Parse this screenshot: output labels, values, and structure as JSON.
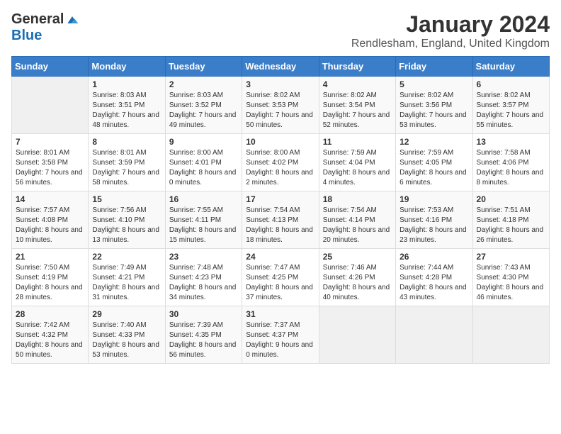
{
  "logo": {
    "general": "General",
    "blue": "Blue"
  },
  "title": "January 2024",
  "subtitle": "Rendlesham, England, United Kingdom",
  "days_of_week": [
    "Sunday",
    "Monday",
    "Tuesday",
    "Wednesday",
    "Thursday",
    "Friday",
    "Saturday"
  ],
  "weeks": [
    [
      {
        "day": "",
        "sunrise": "",
        "sunset": "",
        "daylight": ""
      },
      {
        "day": "1",
        "sunrise": "Sunrise: 8:03 AM",
        "sunset": "Sunset: 3:51 PM",
        "daylight": "Daylight: 7 hours and 48 minutes."
      },
      {
        "day": "2",
        "sunrise": "Sunrise: 8:03 AM",
        "sunset": "Sunset: 3:52 PM",
        "daylight": "Daylight: 7 hours and 49 minutes."
      },
      {
        "day": "3",
        "sunrise": "Sunrise: 8:02 AM",
        "sunset": "Sunset: 3:53 PM",
        "daylight": "Daylight: 7 hours and 50 minutes."
      },
      {
        "day": "4",
        "sunrise": "Sunrise: 8:02 AM",
        "sunset": "Sunset: 3:54 PM",
        "daylight": "Daylight: 7 hours and 52 minutes."
      },
      {
        "day": "5",
        "sunrise": "Sunrise: 8:02 AM",
        "sunset": "Sunset: 3:56 PM",
        "daylight": "Daylight: 7 hours and 53 minutes."
      },
      {
        "day": "6",
        "sunrise": "Sunrise: 8:02 AM",
        "sunset": "Sunset: 3:57 PM",
        "daylight": "Daylight: 7 hours and 55 minutes."
      }
    ],
    [
      {
        "day": "7",
        "sunrise": "Sunrise: 8:01 AM",
        "sunset": "Sunset: 3:58 PM",
        "daylight": "Daylight: 7 hours and 56 minutes."
      },
      {
        "day": "8",
        "sunrise": "Sunrise: 8:01 AM",
        "sunset": "Sunset: 3:59 PM",
        "daylight": "Daylight: 7 hours and 58 minutes."
      },
      {
        "day": "9",
        "sunrise": "Sunrise: 8:00 AM",
        "sunset": "Sunset: 4:01 PM",
        "daylight": "Daylight: 8 hours and 0 minutes."
      },
      {
        "day": "10",
        "sunrise": "Sunrise: 8:00 AM",
        "sunset": "Sunset: 4:02 PM",
        "daylight": "Daylight: 8 hours and 2 minutes."
      },
      {
        "day": "11",
        "sunrise": "Sunrise: 7:59 AM",
        "sunset": "Sunset: 4:04 PM",
        "daylight": "Daylight: 8 hours and 4 minutes."
      },
      {
        "day": "12",
        "sunrise": "Sunrise: 7:59 AM",
        "sunset": "Sunset: 4:05 PM",
        "daylight": "Daylight: 8 hours and 6 minutes."
      },
      {
        "day": "13",
        "sunrise": "Sunrise: 7:58 AM",
        "sunset": "Sunset: 4:06 PM",
        "daylight": "Daylight: 8 hours and 8 minutes."
      }
    ],
    [
      {
        "day": "14",
        "sunrise": "Sunrise: 7:57 AM",
        "sunset": "Sunset: 4:08 PM",
        "daylight": "Daylight: 8 hours and 10 minutes."
      },
      {
        "day": "15",
        "sunrise": "Sunrise: 7:56 AM",
        "sunset": "Sunset: 4:10 PM",
        "daylight": "Daylight: 8 hours and 13 minutes."
      },
      {
        "day": "16",
        "sunrise": "Sunrise: 7:55 AM",
        "sunset": "Sunset: 4:11 PM",
        "daylight": "Daylight: 8 hours and 15 minutes."
      },
      {
        "day": "17",
        "sunrise": "Sunrise: 7:54 AM",
        "sunset": "Sunset: 4:13 PM",
        "daylight": "Daylight: 8 hours and 18 minutes."
      },
      {
        "day": "18",
        "sunrise": "Sunrise: 7:54 AM",
        "sunset": "Sunset: 4:14 PM",
        "daylight": "Daylight: 8 hours and 20 minutes."
      },
      {
        "day": "19",
        "sunrise": "Sunrise: 7:53 AM",
        "sunset": "Sunset: 4:16 PM",
        "daylight": "Daylight: 8 hours and 23 minutes."
      },
      {
        "day": "20",
        "sunrise": "Sunrise: 7:51 AM",
        "sunset": "Sunset: 4:18 PM",
        "daylight": "Daylight: 8 hours and 26 minutes."
      }
    ],
    [
      {
        "day": "21",
        "sunrise": "Sunrise: 7:50 AM",
        "sunset": "Sunset: 4:19 PM",
        "daylight": "Daylight: 8 hours and 28 minutes."
      },
      {
        "day": "22",
        "sunrise": "Sunrise: 7:49 AM",
        "sunset": "Sunset: 4:21 PM",
        "daylight": "Daylight: 8 hours and 31 minutes."
      },
      {
        "day": "23",
        "sunrise": "Sunrise: 7:48 AM",
        "sunset": "Sunset: 4:23 PM",
        "daylight": "Daylight: 8 hours and 34 minutes."
      },
      {
        "day": "24",
        "sunrise": "Sunrise: 7:47 AM",
        "sunset": "Sunset: 4:25 PM",
        "daylight": "Daylight: 8 hours and 37 minutes."
      },
      {
        "day": "25",
        "sunrise": "Sunrise: 7:46 AM",
        "sunset": "Sunset: 4:26 PM",
        "daylight": "Daylight: 8 hours and 40 minutes."
      },
      {
        "day": "26",
        "sunrise": "Sunrise: 7:44 AM",
        "sunset": "Sunset: 4:28 PM",
        "daylight": "Daylight: 8 hours and 43 minutes."
      },
      {
        "day": "27",
        "sunrise": "Sunrise: 7:43 AM",
        "sunset": "Sunset: 4:30 PM",
        "daylight": "Daylight: 8 hours and 46 minutes."
      }
    ],
    [
      {
        "day": "28",
        "sunrise": "Sunrise: 7:42 AM",
        "sunset": "Sunset: 4:32 PM",
        "daylight": "Daylight: 8 hours and 50 minutes."
      },
      {
        "day": "29",
        "sunrise": "Sunrise: 7:40 AM",
        "sunset": "Sunset: 4:33 PM",
        "daylight": "Daylight: 8 hours and 53 minutes."
      },
      {
        "day": "30",
        "sunrise": "Sunrise: 7:39 AM",
        "sunset": "Sunset: 4:35 PM",
        "daylight": "Daylight: 8 hours and 56 minutes."
      },
      {
        "day": "31",
        "sunrise": "Sunrise: 7:37 AM",
        "sunset": "Sunset: 4:37 PM",
        "daylight": "Daylight: 9 hours and 0 minutes."
      },
      {
        "day": "",
        "sunrise": "",
        "sunset": "",
        "daylight": ""
      },
      {
        "day": "",
        "sunrise": "",
        "sunset": "",
        "daylight": ""
      },
      {
        "day": "",
        "sunrise": "",
        "sunset": "",
        "daylight": ""
      }
    ]
  ]
}
